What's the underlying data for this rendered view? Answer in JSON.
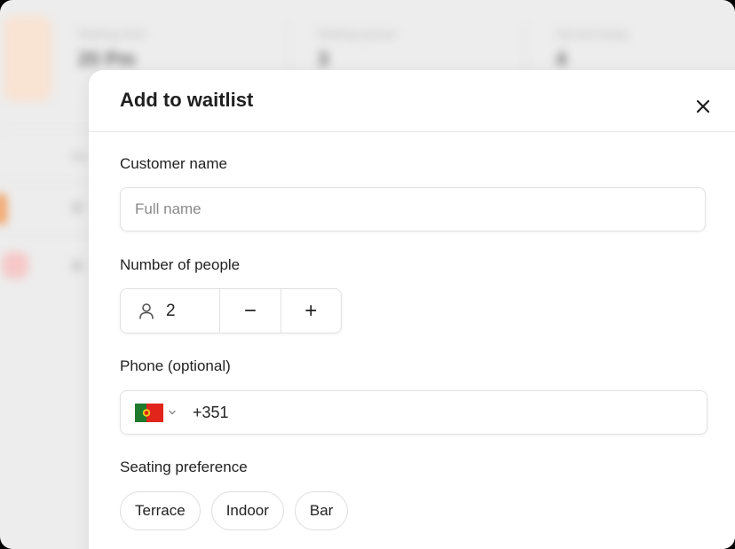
{
  "background": {
    "stats": [
      {
        "label": "Waiting time",
        "value": "20 Pm"
      },
      {
        "label": "Waiting queue",
        "value": "3"
      },
      {
        "label": "Served today",
        "value": "4"
      }
    ],
    "table_header": "Na"
  },
  "modal": {
    "title": "Add to waitlist",
    "close_icon": "close-icon",
    "customer_name": {
      "label": "Customer name",
      "placeholder": "Full name",
      "value": ""
    },
    "party_size": {
      "label": "Number of people",
      "value": "2",
      "decrement": "−",
      "increment": "+"
    },
    "phone": {
      "label": "Phone (optional)",
      "country_flag": "portugal-flag",
      "dial_code": "+351"
    },
    "seating": {
      "label": "Seating preference",
      "options": [
        "Terrace",
        "Indoor",
        "Bar"
      ]
    }
  },
  "colors": {
    "accent_tile": "#f9e3d3",
    "flag_green": "#1f7a2c",
    "flag_red": "#e1251b",
    "text": "#222222"
  }
}
